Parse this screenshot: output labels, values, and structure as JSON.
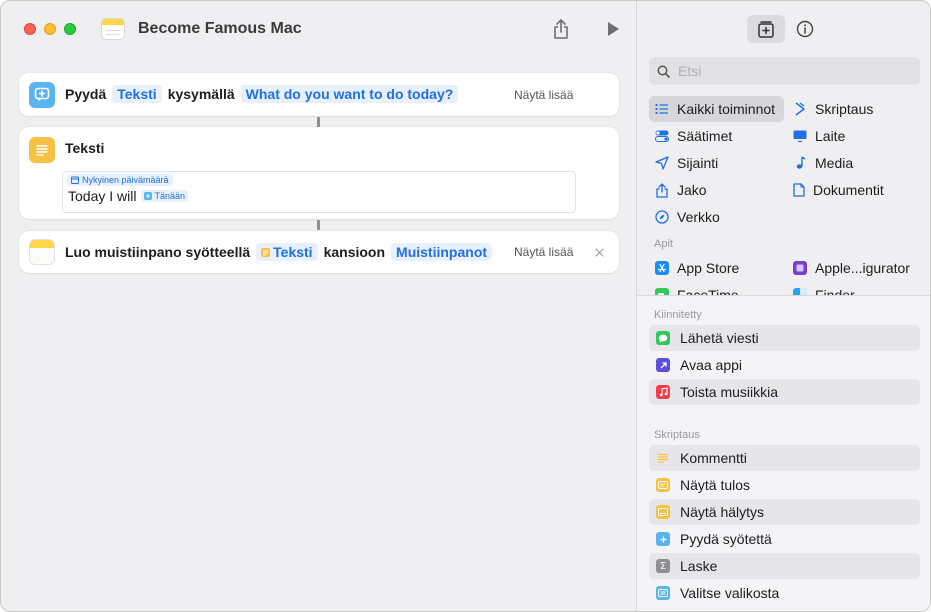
{
  "window": {
    "title": "Become Famous Mac"
  },
  "actions": [
    {
      "verb": "Pyydä",
      "token1": "Teksti",
      "connector": "kysymällä",
      "token2": "What do you want to do today?",
      "show_more": "Näytä lisää"
    },
    {
      "title": "Teksti",
      "date_chip": "Nykyinen päivämäärä",
      "text": "Today I will",
      "today_chip": "Tänään"
    },
    {
      "verb": "Luo muistiinpano syötteellä",
      "token1": "Teksti",
      "connector": "kansioon",
      "token2": "Muistiinpanot",
      "show_more": "Näytä lisää"
    }
  ],
  "sidebar": {
    "search_placeholder": "Etsi",
    "categories_left": [
      "Kaikki toiminnot",
      "Säätimet",
      "Sijainti",
      "Jako",
      "Verkko"
    ],
    "categories_right": [
      "Skriptaus",
      "Laite",
      "Media",
      "Dokumentit"
    ],
    "apps_label": "Apit",
    "apps_left": [
      "App Store",
      "FaceTime"
    ],
    "apps_right": [
      "Apple...igurator",
      "Finder"
    ],
    "pinned_label": "Kiinnitetty",
    "pinned": [
      "Lähetä viesti",
      "Avaa appi",
      "Toista musiikkia"
    ],
    "scripting_label": "Skriptaus",
    "scripting": [
      "Kommentti",
      "Näytä tulos",
      "Näytä hälytys",
      "Pyydä syötettä",
      "Laske",
      "Valitse valikosta"
    ]
  }
}
